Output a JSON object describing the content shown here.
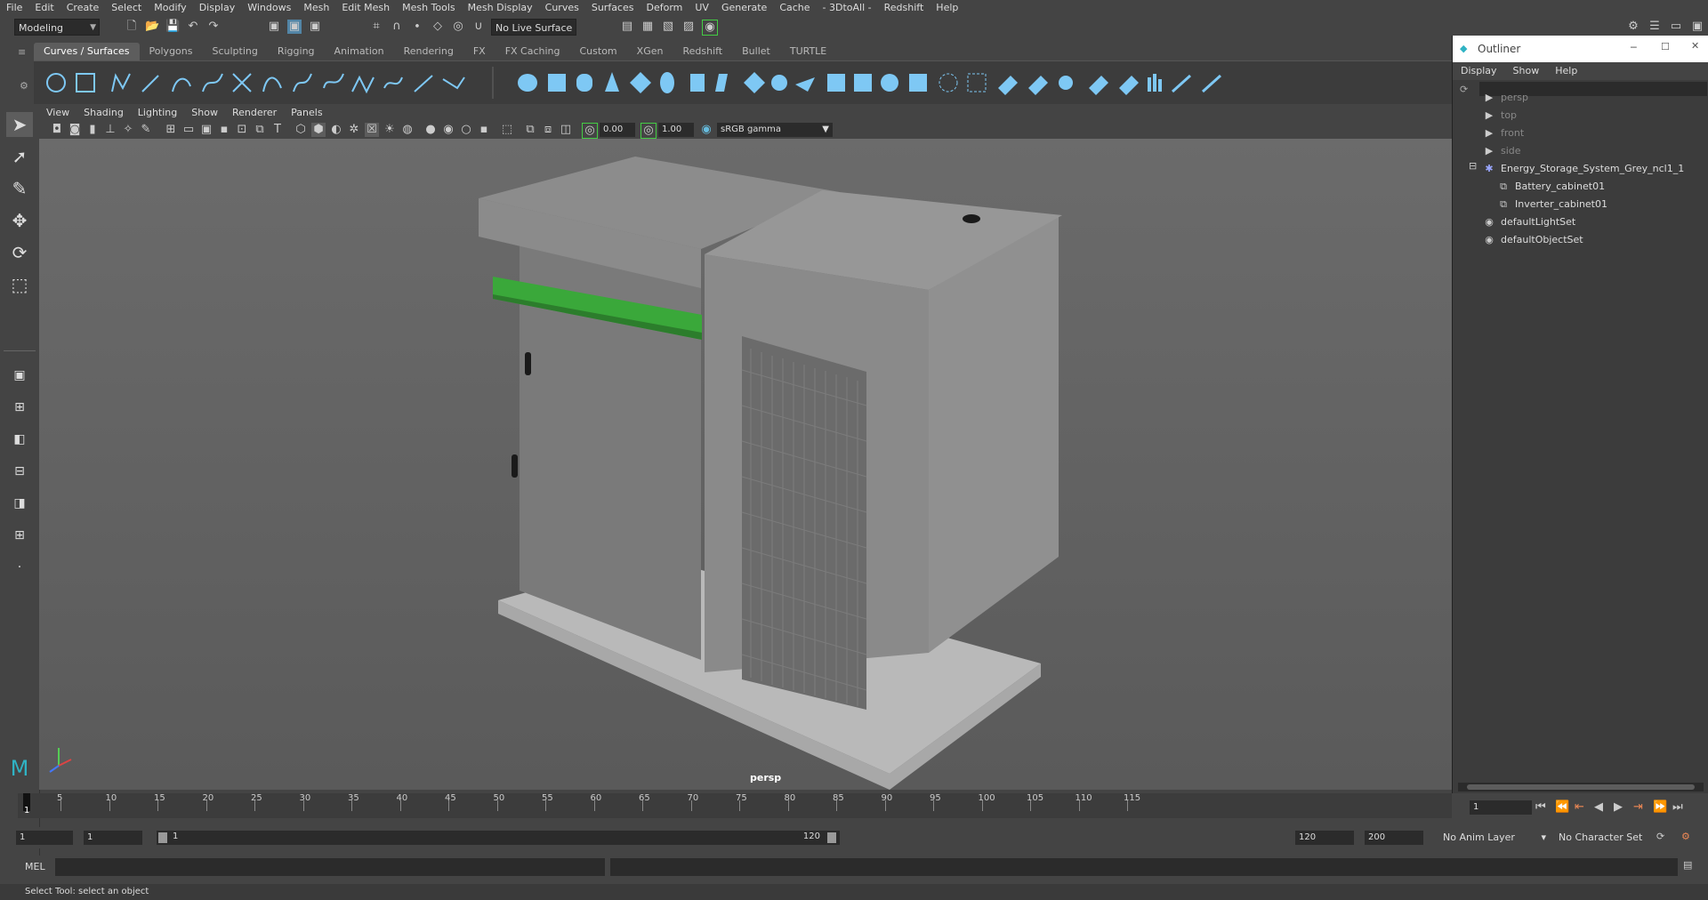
{
  "menubar": [
    "File",
    "Edit",
    "Create",
    "Select",
    "Modify",
    "Display",
    "Windows",
    "Mesh",
    "Edit Mesh",
    "Mesh Tools",
    "Mesh Display",
    "Curves",
    "Surfaces",
    "Deform",
    "UV",
    "Generate",
    "Cache",
    "- 3DtoAll -",
    "Redshift",
    "Help"
  ],
  "status": {
    "mode": "Modeling",
    "live_surface": "No Live Surface"
  },
  "shelf_tabs": [
    "Curves / Surfaces",
    "Polygons",
    "Sculpting",
    "Rigging",
    "Animation",
    "Rendering",
    "FX",
    "FX Caching",
    "Custom",
    "XGen",
    "Redshift",
    "Bullet",
    "TURTLE"
  ],
  "panel_menu": [
    "View",
    "Shading",
    "Lighting",
    "Show",
    "Renderer",
    "Panels"
  ],
  "panel_toolbar": {
    "exposure": "0.00",
    "gamma": "1.00",
    "color_space": "sRGB gamma"
  },
  "viewport": {
    "camera_label": "persp"
  },
  "outliner": {
    "title": "Outliner",
    "menu": [
      "Display",
      "Show",
      "Help"
    ],
    "items": [
      {
        "label": "persp",
        "icon": "camera-icon"
      },
      {
        "label": "top",
        "icon": "camera-icon"
      },
      {
        "label": "front",
        "icon": "camera-icon"
      },
      {
        "label": "side",
        "icon": "camera-icon"
      },
      {
        "label": "Energy_Storage_System_Grey_ncl1_1",
        "icon": "group-icon"
      },
      {
        "label": "Battery_cabinet01",
        "icon": "mesh-icon"
      },
      {
        "label": "Inverter_cabinet01",
        "icon": "mesh-icon"
      },
      {
        "label": "defaultLightSet",
        "icon": "set-icon"
      },
      {
        "label": "defaultObjectSet",
        "icon": "set-icon"
      }
    ]
  },
  "timeline": {
    "ticks": [
      "5",
      "10",
      "15",
      "20",
      "25",
      "30",
      "35",
      "40",
      "45",
      "50",
      "55",
      "60",
      "65",
      "70",
      "75",
      "80",
      "85",
      "90",
      "95",
      "100",
      "105",
      "110",
      "115"
    ],
    "current_frame": "1",
    "current_frame_field": "1"
  },
  "range": {
    "start": "1",
    "playback_start": "1",
    "slider_start": "1",
    "slider_end": "120",
    "playback_end": "120",
    "end": "200",
    "anim_layer": "No Anim Layer",
    "character_set": "No Character Set"
  },
  "command_line": {
    "label": "MEL"
  },
  "help_line": "Select Tool: select an object"
}
